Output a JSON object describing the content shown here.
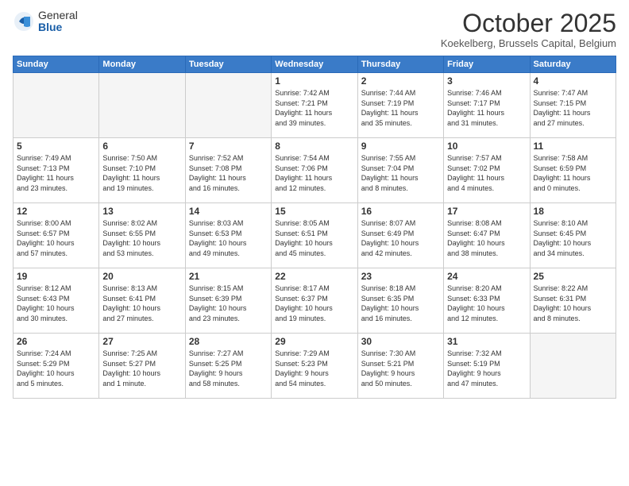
{
  "header": {
    "logo_general": "General",
    "logo_blue": "Blue",
    "month_title": "October 2025",
    "subtitle": "Koekelberg, Brussels Capital, Belgium"
  },
  "weekdays": [
    "Sunday",
    "Monday",
    "Tuesday",
    "Wednesday",
    "Thursday",
    "Friday",
    "Saturday"
  ],
  "weeks": [
    [
      {
        "day": "",
        "info": ""
      },
      {
        "day": "",
        "info": ""
      },
      {
        "day": "",
        "info": ""
      },
      {
        "day": "1",
        "info": "Sunrise: 7:42 AM\nSunset: 7:21 PM\nDaylight: 11 hours\nand 39 minutes."
      },
      {
        "day": "2",
        "info": "Sunrise: 7:44 AM\nSunset: 7:19 PM\nDaylight: 11 hours\nand 35 minutes."
      },
      {
        "day": "3",
        "info": "Sunrise: 7:46 AM\nSunset: 7:17 PM\nDaylight: 11 hours\nand 31 minutes."
      },
      {
        "day": "4",
        "info": "Sunrise: 7:47 AM\nSunset: 7:15 PM\nDaylight: 11 hours\nand 27 minutes."
      }
    ],
    [
      {
        "day": "5",
        "info": "Sunrise: 7:49 AM\nSunset: 7:13 PM\nDaylight: 11 hours\nand 23 minutes."
      },
      {
        "day": "6",
        "info": "Sunrise: 7:50 AM\nSunset: 7:10 PM\nDaylight: 11 hours\nand 19 minutes."
      },
      {
        "day": "7",
        "info": "Sunrise: 7:52 AM\nSunset: 7:08 PM\nDaylight: 11 hours\nand 16 minutes."
      },
      {
        "day": "8",
        "info": "Sunrise: 7:54 AM\nSunset: 7:06 PM\nDaylight: 11 hours\nand 12 minutes."
      },
      {
        "day": "9",
        "info": "Sunrise: 7:55 AM\nSunset: 7:04 PM\nDaylight: 11 hours\nand 8 minutes."
      },
      {
        "day": "10",
        "info": "Sunrise: 7:57 AM\nSunset: 7:02 PM\nDaylight: 11 hours\nand 4 minutes."
      },
      {
        "day": "11",
        "info": "Sunrise: 7:58 AM\nSunset: 6:59 PM\nDaylight: 11 hours\nand 0 minutes."
      }
    ],
    [
      {
        "day": "12",
        "info": "Sunrise: 8:00 AM\nSunset: 6:57 PM\nDaylight: 10 hours\nand 57 minutes."
      },
      {
        "day": "13",
        "info": "Sunrise: 8:02 AM\nSunset: 6:55 PM\nDaylight: 10 hours\nand 53 minutes."
      },
      {
        "day": "14",
        "info": "Sunrise: 8:03 AM\nSunset: 6:53 PM\nDaylight: 10 hours\nand 49 minutes."
      },
      {
        "day": "15",
        "info": "Sunrise: 8:05 AM\nSunset: 6:51 PM\nDaylight: 10 hours\nand 45 minutes."
      },
      {
        "day": "16",
        "info": "Sunrise: 8:07 AM\nSunset: 6:49 PM\nDaylight: 10 hours\nand 42 minutes."
      },
      {
        "day": "17",
        "info": "Sunrise: 8:08 AM\nSunset: 6:47 PM\nDaylight: 10 hours\nand 38 minutes."
      },
      {
        "day": "18",
        "info": "Sunrise: 8:10 AM\nSunset: 6:45 PM\nDaylight: 10 hours\nand 34 minutes."
      }
    ],
    [
      {
        "day": "19",
        "info": "Sunrise: 8:12 AM\nSunset: 6:43 PM\nDaylight: 10 hours\nand 30 minutes."
      },
      {
        "day": "20",
        "info": "Sunrise: 8:13 AM\nSunset: 6:41 PM\nDaylight: 10 hours\nand 27 minutes."
      },
      {
        "day": "21",
        "info": "Sunrise: 8:15 AM\nSunset: 6:39 PM\nDaylight: 10 hours\nand 23 minutes."
      },
      {
        "day": "22",
        "info": "Sunrise: 8:17 AM\nSunset: 6:37 PM\nDaylight: 10 hours\nand 19 minutes."
      },
      {
        "day": "23",
        "info": "Sunrise: 8:18 AM\nSunset: 6:35 PM\nDaylight: 10 hours\nand 16 minutes."
      },
      {
        "day": "24",
        "info": "Sunrise: 8:20 AM\nSunset: 6:33 PM\nDaylight: 10 hours\nand 12 minutes."
      },
      {
        "day": "25",
        "info": "Sunrise: 8:22 AM\nSunset: 6:31 PM\nDaylight: 10 hours\nand 8 minutes."
      }
    ],
    [
      {
        "day": "26",
        "info": "Sunrise: 7:24 AM\nSunset: 5:29 PM\nDaylight: 10 hours\nand 5 minutes."
      },
      {
        "day": "27",
        "info": "Sunrise: 7:25 AM\nSunset: 5:27 PM\nDaylight: 10 hours\nand 1 minute."
      },
      {
        "day": "28",
        "info": "Sunrise: 7:27 AM\nSunset: 5:25 PM\nDaylight: 9 hours\nand 58 minutes."
      },
      {
        "day": "29",
        "info": "Sunrise: 7:29 AM\nSunset: 5:23 PM\nDaylight: 9 hours\nand 54 minutes."
      },
      {
        "day": "30",
        "info": "Sunrise: 7:30 AM\nSunset: 5:21 PM\nDaylight: 9 hours\nand 50 minutes."
      },
      {
        "day": "31",
        "info": "Sunrise: 7:32 AM\nSunset: 5:19 PM\nDaylight: 9 hours\nand 47 minutes."
      },
      {
        "day": "",
        "info": ""
      }
    ]
  ]
}
